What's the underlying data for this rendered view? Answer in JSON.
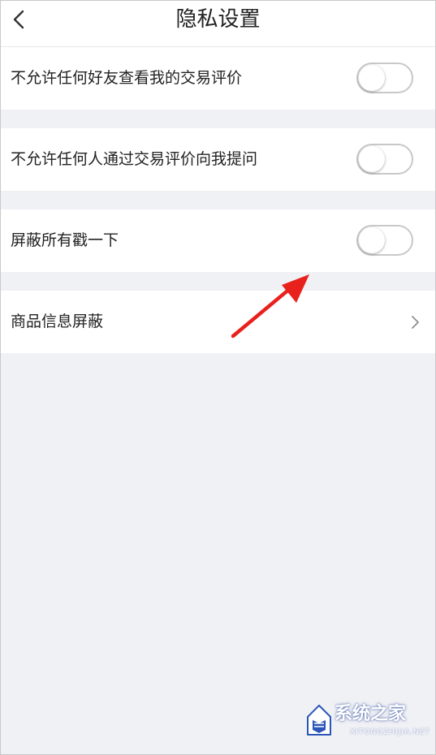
{
  "header": {
    "title": "隐私设置",
    "back_icon": "chevron-left-icon"
  },
  "settings": [
    {
      "label": "不允许任何好友查看我的交易评价",
      "control": "toggle",
      "on": false
    },
    {
      "label": "不允许任何人通过交易评价向我提问",
      "control": "toggle",
      "on": false
    },
    {
      "label": "屏蔽所有戳一下",
      "control": "toggle",
      "on": false
    },
    {
      "label": "商品信息屏蔽",
      "control": "chevron-right-icon"
    }
  ],
  "annotation": {
    "icon": "red-arrow",
    "color": "#e8211c"
  },
  "watermark": {
    "text": "系统之家",
    "url": "XITONGZHIJIA.NET"
  },
  "colors": {
    "background": "#f0f1f5",
    "row": "#ffffff",
    "toggle_border": "#c8c8c8"
  }
}
